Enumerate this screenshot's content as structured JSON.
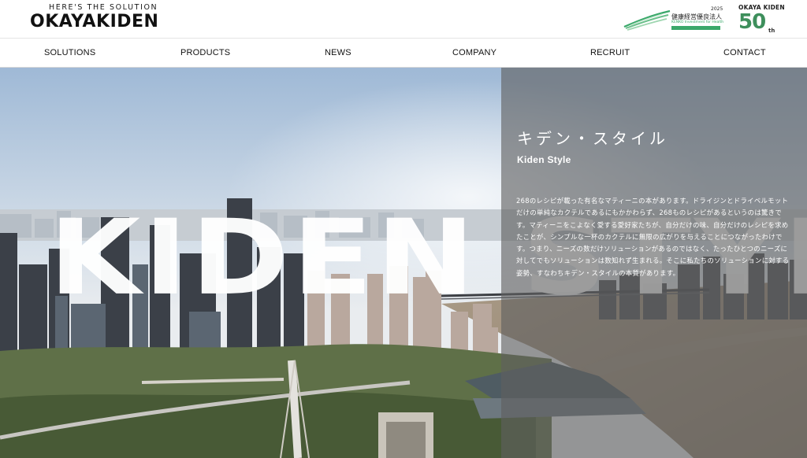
{
  "header": {
    "logo_tagline": "HERE'S THE SOLUTION",
    "logo_name": "OKAYAKIDEN",
    "health_badge": {
      "title": "健康経営優良法人",
      "year": "2025",
      "subtitle": "KENKO Investment for Health"
    },
    "anniversary": {
      "company": "OKAYA KIDEN",
      "number": "50",
      "suffix": "th"
    }
  },
  "nav": {
    "items": [
      {
        "label": "SOLUTIONS"
      },
      {
        "label": "PRODUCTS"
      },
      {
        "label": "NEWS"
      },
      {
        "label": "COMPANY"
      },
      {
        "label": "RECRUIT"
      },
      {
        "label": "CONTACT"
      }
    ]
  },
  "hero": {
    "big_word": "KIDEN STYLE",
    "title_jp": "キデン・スタイル",
    "title_en": "Kiden Style",
    "paragraph": "268のレシピが載った有名なマティーニの本があります。ドライジンとドライベルモットだけの単純なカクテルであるにもかかわらず、268ものレシピがあるというのは驚きです。マティーニをこよなく愛する愛好家たちが、自分だけの味、自分だけのレシピを求めたことが、シンプルな一杯のカクテルに無限の広がりを与えることにつながったわけです。つまり、ニーズの数だけソリューションがあるのではなく、たったひとつのニーズに対してでもソリューションは数知れず生まれる。そこに私たちのソリューションに対する姿勢、すなわちキデン・スタイルの本質があります。"
  },
  "colors": {
    "brand_green": "#3e8f5c",
    "overlay": "#606060",
    "text_dark": "#111111"
  }
}
